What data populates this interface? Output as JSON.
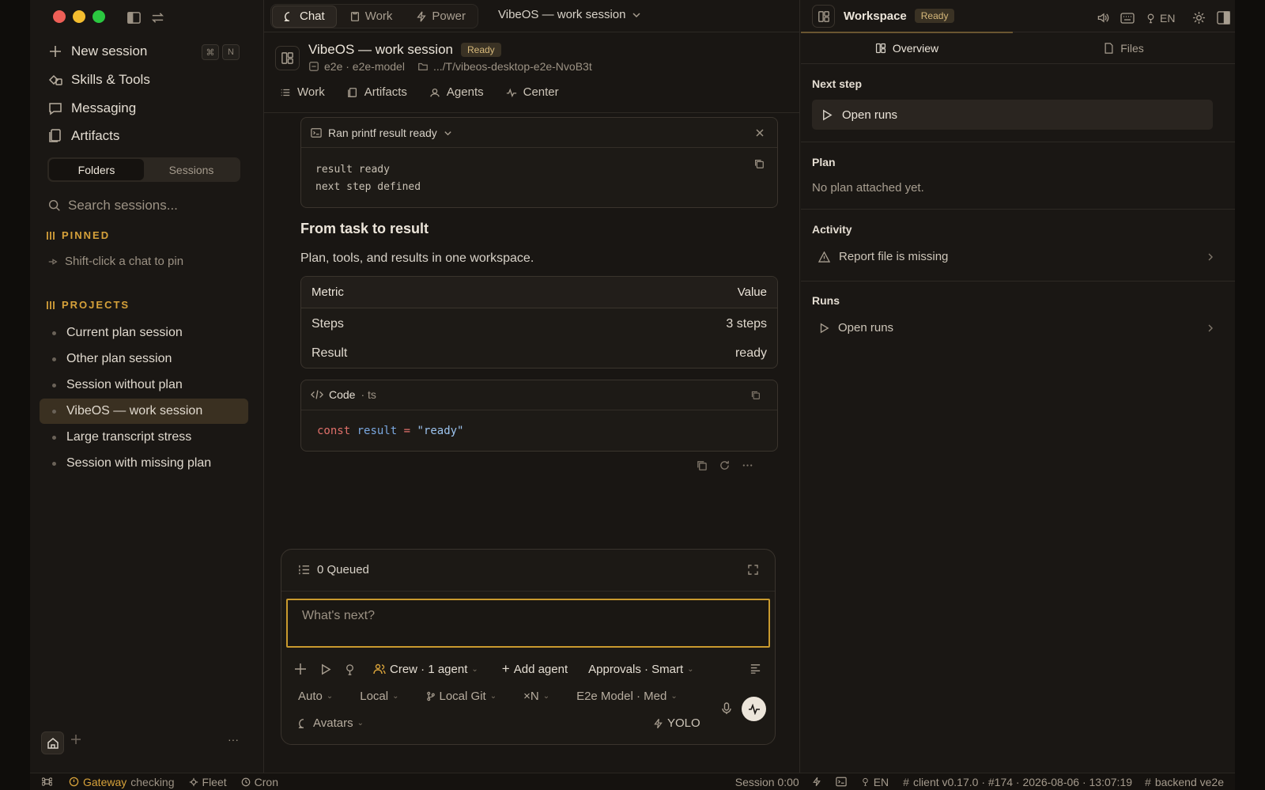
{
  "window": {
    "traffic": [
      "close",
      "minimize",
      "maximize"
    ]
  },
  "sidebar": {
    "new_session": "New session",
    "shortcut_keys": [
      "⌘",
      "N"
    ],
    "nav": [
      {
        "label": "Skills & Tools",
        "icon": "skills-icon"
      },
      {
        "label": "Messaging",
        "icon": "message-icon"
      },
      {
        "label": "Artifacts",
        "icon": "artifacts-icon"
      }
    ],
    "segment": {
      "folders": "Folders",
      "sessions": "Sessions",
      "selected": "Folders"
    },
    "search_placeholder": "Search sessions...",
    "pinned_label": "PINNED",
    "pinned_hint": "Shift-click a chat to pin",
    "projects_label": "PROJECTS",
    "projects": [
      "Current plan session",
      "Other plan session",
      "Session without plan",
      "VibeOS — work session",
      "Large transcript stress",
      "Session with missing plan"
    ],
    "active_project": "VibeOS — work session",
    "footer_more": "···"
  },
  "topbar": {
    "modes": [
      "Chat",
      "Work",
      "Power"
    ],
    "active_mode": "Chat",
    "session_title": "VibeOS — work session"
  },
  "session": {
    "title": "VibeOS — work session",
    "status": "Ready",
    "model": "e2e · e2e-model",
    "path": ".../T/vibeos-desktop-e2e-NvoB3t",
    "tabs": [
      "Work",
      "Artifacts",
      "Agents",
      "Center"
    ]
  },
  "transcript": {
    "tool": {
      "title": "Ran printf result ready",
      "output": [
        "result ready",
        "next step defined"
      ]
    },
    "heading": "From task to result",
    "paragraph": "Plan, tools, and results in one workspace.",
    "table": {
      "headers": [
        "Metric",
        "Value"
      ],
      "rows": [
        [
          "Steps",
          "3 steps"
        ],
        [
          "Result",
          "ready"
        ]
      ]
    },
    "code": {
      "label": "Code",
      "lang": "· ts",
      "kw": "const",
      "var": "result",
      "op": "=",
      "str": "\"ready\""
    }
  },
  "composer": {
    "queued": "0 Queued",
    "placeholder": "What's next?",
    "crew": "Crew · 1 agent",
    "add_agent": "Add agent",
    "approvals": "Approvals · Smart",
    "auto": "Auto",
    "local": "Local",
    "git": "Local Git",
    "multi": "×N",
    "model": "E2e Model · Med",
    "avatars": "Avatars",
    "yolo": "YOLO"
  },
  "workspace": {
    "title": "Workspace",
    "status": "Ready",
    "lang": "EN",
    "tabs": [
      "Overview",
      "Files"
    ],
    "active_tab": "Overview",
    "next_step_label": "Next step",
    "next_step_action": "Open runs",
    "plan_label": "Plan",
    "plan_text": "No plan attached yet.",
    "activity_label": "Activity",
    "activity_item": "Report file is missing",
    "runs_label": "Runs",
    "runs_item": "Open runs"
  },
  "statusbar": {
    "gateway": "Gateway",
    "gateway_state": "checking",
    "fleet": "Fleet",
    "cron": "Cron",
    "session_time": "Session 0:00",
    "lang": "EN",
    "client": "client v0.17.0 · #174 · 2026-08-06 · 13:07:19",
    "backend": "backend ve2e"
  },
  "colors": {
    "accent": "#d6a13a",
    "background": "#1a1714",
    "active_row": "#3a3021"
  }
}
